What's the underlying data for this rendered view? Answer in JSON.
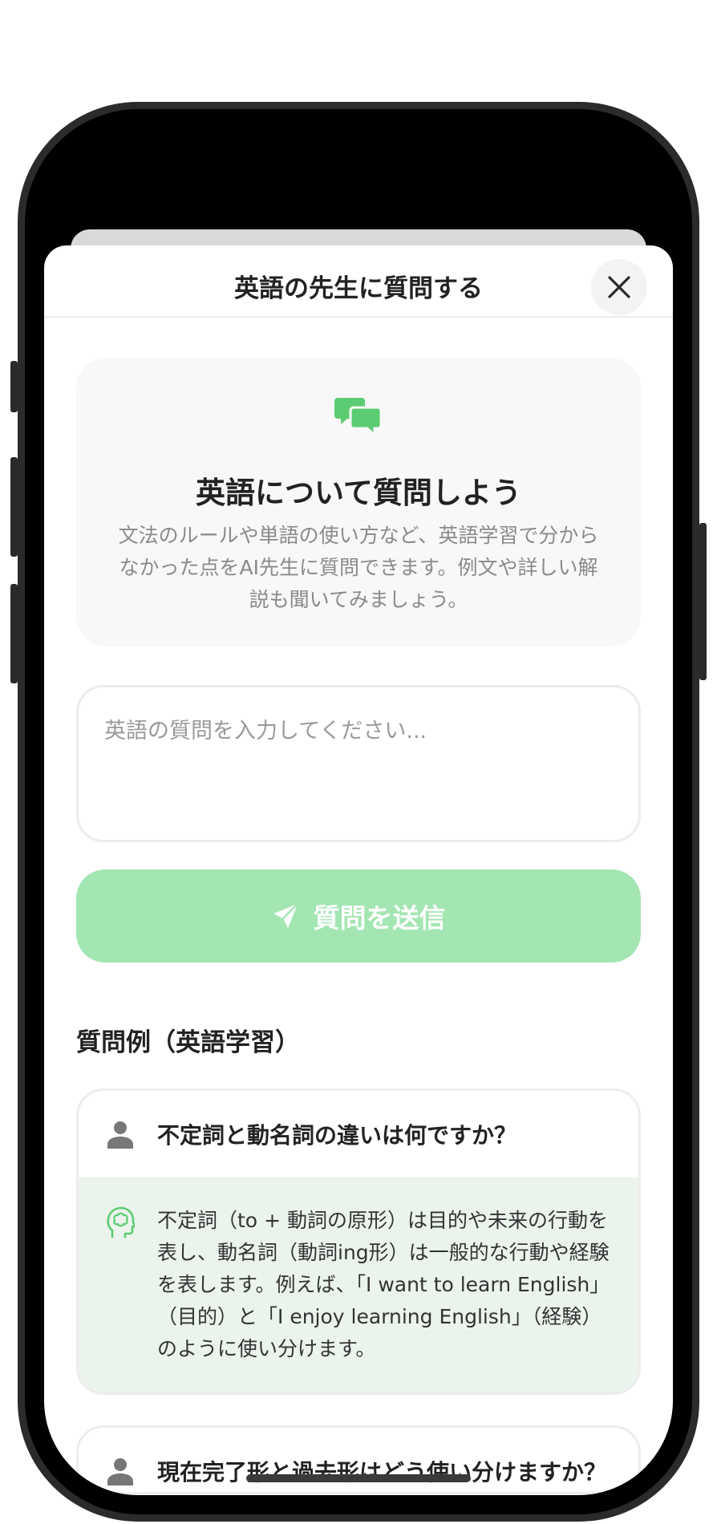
{
  "header": {
    "title": "英語の先生に質問する"
  },
  "intro": {
    "title": "英語について質問しよう",
    "description": "文法のルールや単語の使い方など、英語学習で分からなかった点をAI先生に質問できます。例文や詳しい解説も聞いてみましょう。"
  },
  "question_input": {
    "placeholder": "英語の質問を入力してください...",
    "value": ""
  },
  "send_button": {
    "label": "質問を送信"
  },
  "examples": {
    "section_title": "質問例（英語学習）",
    "items": [
      {
        "question": "不定詞と動名詞の違いは何ですか？",
        "answer": "不定詞（to + 動詞の原形）は目的や未来の行動を表し、動名詞（動詞ing形）は一般的な行動や経験を表します。例えば、「I want to learn English」（目的）と「I enjoy learning English」（経験）のように使い分けます。"
      },
      {
        "question": "現在完了形と過去形はどう使い分けますか？"
      }
    ]
  },
  "colors": {
    "accent": "#5ccc73",
    "button_disabled": "#a3e6b2",
    "answer_bg": "#eaf3ec"
  },
  "icons": {
    "close": "close-icon",
    "chat": "chat-bubbles-icon",
    "send": "send-icon",
    "user": "user-icon",
    "brain": "brain-head-icon"
  }
}
